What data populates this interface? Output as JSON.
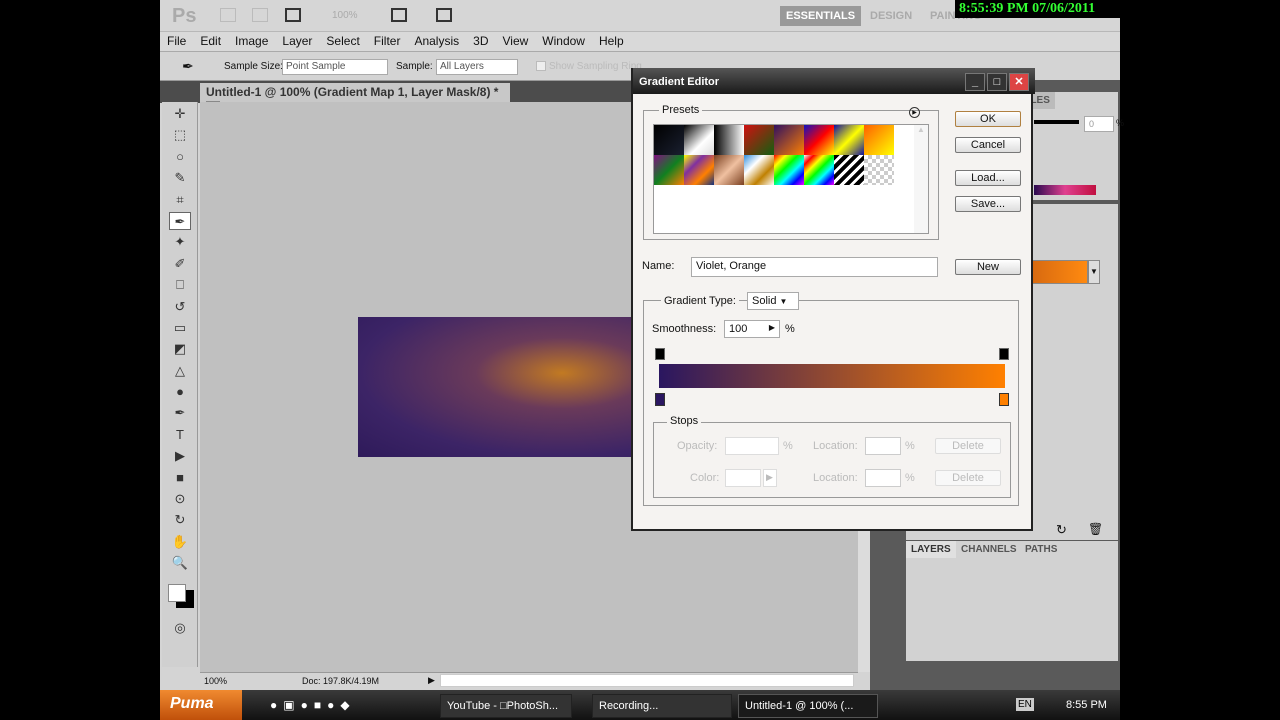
{
  "clock_overlay": "8:55:39 PM 07/06/2011",
  "topbar": {
    "logo": "Ps",
    "zoom": "100%",
    "workspaces": [
      "ESSENTIALS",
      "DESIGN",
      "PAINTING"
    ]
  },
  "menu": [
    "File",
    "Edit",
    "Image",
    "Layer",
    "Select",
    "Filter",
    "Analysis",
    "3D",
    "View",
    "Window",
    "Help"
  ],
  "options": {
    "sample_size_label": "Sample Size:",
    "sample_size_value": "Point Sample",
    "sample_label": "Sample:",
    "sample_value": "All Layers",
    "show_ring": "Show Sampling Ring"
  },
  "document": {
    "tab_title": "Untitled-1 @ 100% (Gradient Map 1, Layer Mask/8) *",
    "zoom": "100%",
    "doc_info": "Doc: 197.8K/4.19M"
  },
  "panels": {
    "styles_tab": "STYLES",
    "opacity_value": "0",
    "percent": "%",
    "layers_tabs": [
      "LAYERS",
      "CHANNELS",
      "PATHS"
    ],
    "gradient_preview_color": "#f07a10"
  },
  "dialog": {
    "title": "Gradient Editor",
    "presets_label": "Presets",
    "buttons": {
      "ok": "OK",
      "cancel": "Cancel",
      "load": "Load...",
      "save": "Save...",
      "new": "New"
    },
    "name_label": "Name:",
    "name_value": "Violet, Orange",
    "gradient_type_label": "Gradient Type:",
    "gradient_type_value": "Solid",
    "smoothness_label": "Smoothness:",
    "smoothness_value": "100",
    "percent": "%",
    "gradient": {
      "start_color": "#2a1660",
      "end_color": "#ff8000"
    },
    "stops": {
      "label": "Stops",
      "opacity_label": "Opacity:",
      "color_label": "Color:",
      "location_label": "Location:",
      "delete": "Delete"
    }
  },
  "taskbar": {
    "start": "Puma",
    "tasks": [
      "YouTube - □PhotoSh...",
      "Recording...",
      "Untitled-1 @ 100% (..."
    ],
    "lang": "EN",
    "time": "8:55 PM"
  }
}
